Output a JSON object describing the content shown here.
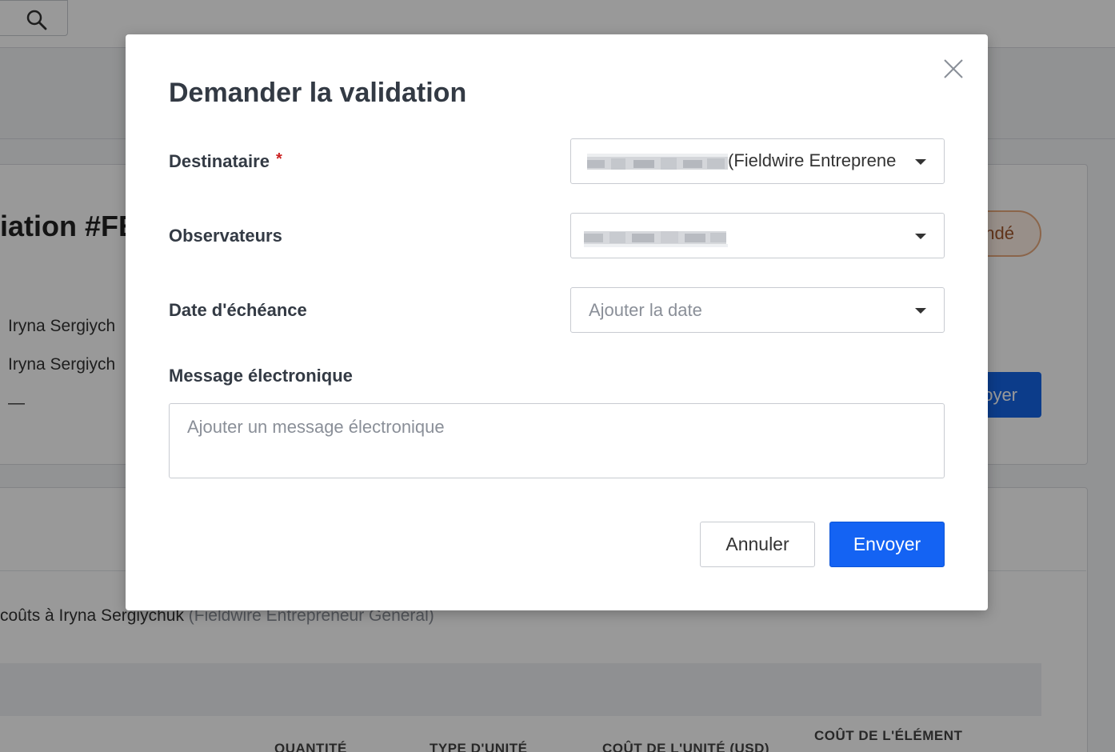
{
  "background": {
    "project_title": "iation #FE",
    "status_label": "ndé",
    "recipient_line_1": "Iryna Sergiych",
    "recipient_line_2": "Iryna Sergiych",
    "empty_value": "—",
    "send_button_label": "oyer",
    "sent_line_prefix": "coûts à Iryna Sergiychuk",
    "sent_line_company": "(Fieldwire Entrepreneur Général)",
    "table_headers": [
      "QUANTITÉ",
      "TYPE D'UNITÉ",
      "COÛT DE L'UNITÉ (USD)",
      "COÛT DE L'ÉLÉMENT"
    ]
  },
  "modal": {
    "title": "Demander la validation",
    "fields": {
      "recipient": {
        "label": "Destinataire",
        "required_mark": "*",
        "value_company": "(Fieldwire Entreprene"
      },
      "observers": {
        "label": "Observateurs"
      },
      "due_date": {
        "label": "Date d'échéance",
        "placeholder": "Ajouter la date"
      },
      "message": {
        "label": "Message électronique",
        "placeholder": "Ajouter un message électronique"
      }
    },
    "buttons": {
      "cancel": "Annuler",
      "send": "Envoyer"
    }
  },
  "colors": {
    "primary": "#1463f3",
    "required": "#cc2222",
    "status_border": "#e8a87c"
  }
}
